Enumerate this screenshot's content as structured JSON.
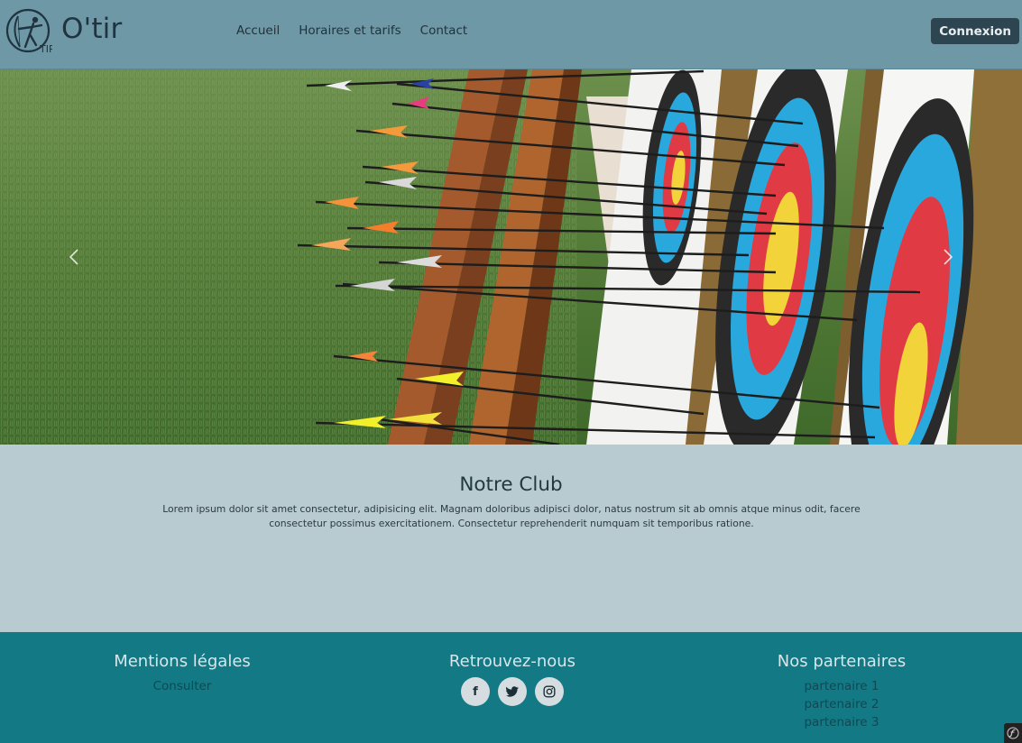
{
  "brand": {
    "name": "O'tir",
    "logo_subtext": "TIR"
  },
  "nav": [
    {
      "label": "Accueil"
    },
    {
      "label": "Horaires et tarifs"
    },
    {
      "label": "Contact"
    }
  ],
  "header": {
    "login_label": "Connexion"
  },
  "carousel": {
    "prev_icon": "chevron-left-icon",
    "next_icon": "chevron-right-icon"
  },
  "club": {
    "title": "Notre Club",
    "text": "Lorem ipsum dolor sit amet consectetur, adipisicing elit. Magnam doloribus adipisci dolor, natus nostrum sit ab omnis atque minus odit, facere consectetur possimus exercitationem. Consectetur reprehenderit numquam sit temporibus ratione."
  },
  "footer": {
    "legal": {
      "title": "Mentions légales",
      "link": "Consulter"
    },
    "social": {
      "title": "Retrouvez-nous",
      "icons": [
        {
          "name": "facebook-icon",
          "glyph": "f"
        },
        {
          "name": "twitter-icon",
          "glyph": "t"
        },
        {
          "name": "instagram-icon",
          "glyph": "◎"
        }
      ]
    },
    "partners": {
      "title": "Nos partenaires",
      "items": [
        "partenaire 1",
        "partenaire 2",
        "partenaire 3"
      ]
    }
  },
  "colors": {
    "navbar": "#6f98a6",
    "section": "#b8cbd1",
    "footer": "#127985",
    "button": "#2c4550"
  }
}
